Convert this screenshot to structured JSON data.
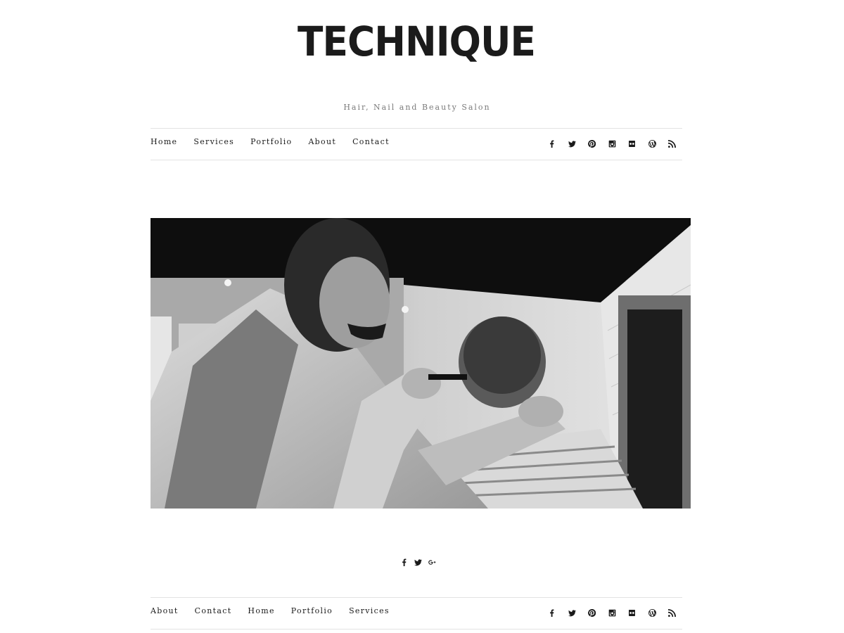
{
  "site": {
    "title": "TECHNIQUE",
    "tagline": "Hair, Nail and Beauty Salon"
  },
  "header_nav": {
    "items": [
      "Home",
      "Services",
      "Portfolio",
      "About",
      "Contact"
    ]
  },
  "footer_nav": {
    "items": [
      "About",
      "Contact",
      "Home",
      "Portfolio",
      "Services"
    ]
  },
  "social_icons": [
    "facebook-icon",
    "twitter-icon",
    "pinterest-icon",
    "instagram-icon",
    "flickr-icon",
    "wordpress-icon",
    "rss-icon"
  ],
  "share_icons": [
    "facebook-icon",
    "twitter-icon",
    "google-plus-icon"
  ],
  "hero_image": {
    "subject": "black-and-white photo of a barber cutting a client's hair"
  },
  "colors": {
    "text": "#1a1a1a",
    "tagline": "#7a7a7a",
    "divider": "#e3e3e3",
    "background": "#ffffff"
  }
}
